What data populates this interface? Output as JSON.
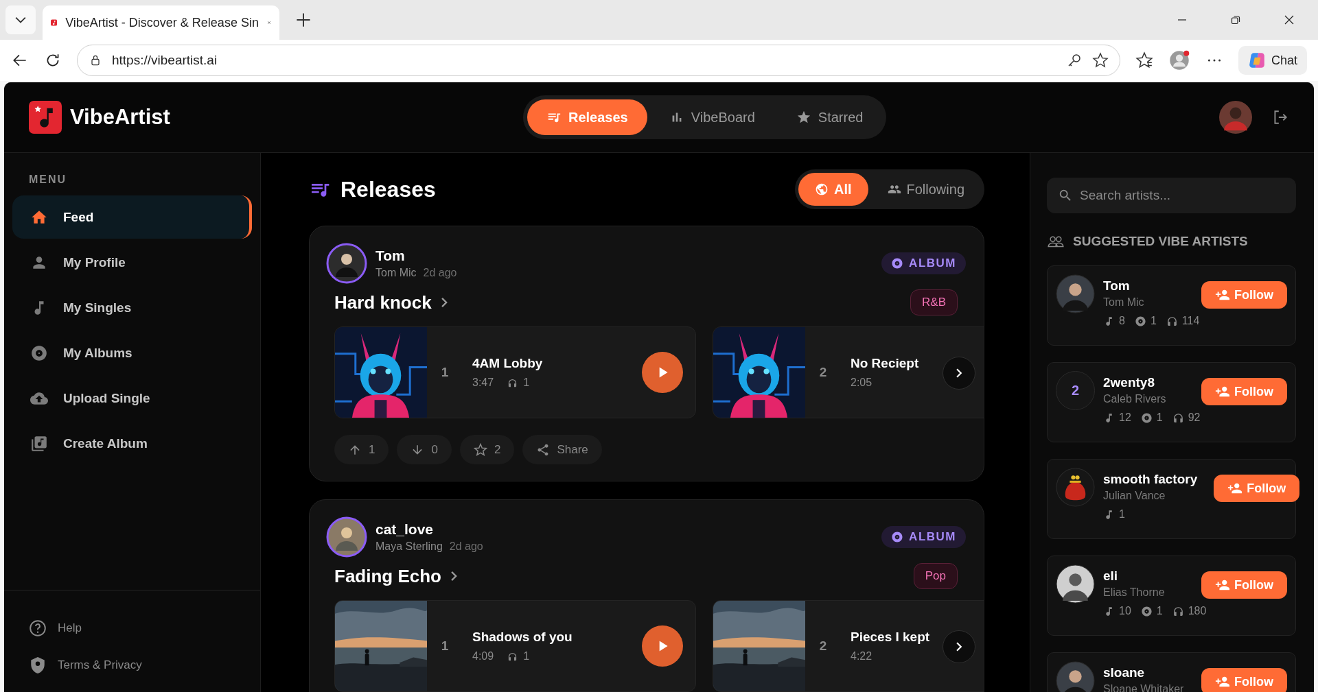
{
  "browser": {
    "tab_title": "VibeArtist - Discover & Release Sin",
    "url": "https://vibeartist.ai",
    "chat_label": "Chat"
  },
  "header": {
    "brand": "VibeArtist",
    "nav": [
      {
        "label": "Releases",
        "selected": true
      },
      {
        "label": "VibeBoard",
        "selected": false
      },
      {
        "label": "Starred",
        "selected": false
      }
    ]
  },
  "sidebar": {
    "menu_label": "MENU",
    "items": [
      {
        "label": "Feed",
        "selected": true
      },
      {
        "label": "My Profile",
        "selected": false
      },
      {
        "label": "My Singles",
        "selected": false
      },
      {
        "label": "My Albums",
        "selected": false
      },
      {
        "label": "Upload Single",
        "selected": false
      },
      {
        "label": "Create Album",
        "selected": false
      }
    ],
    "footer": [
      "Help",
      "Terms & Privacy"
    ]
  },
  "feed": {
    "title": "Releases",
    "filters": [
      {
        "label": "All",
        "selected": true
      },
      {
        "label": "Following",
        "selected": false
      }
    ],
    "posts": [
      {
        "username": "Tom",
        "display_name": "Tom Mic",
        "time": "2d ago",
        "type_label": "ALBUM",
        "title": "Hard knock",
        "genre": "R&B",
        "tracks": [
          {
            "number": "1",
            "title": "4AM Lobby",
            "duration": "3:47",
            "plays": "1"
          },
          {
            "number": "2",
            "title": "No Reciept",
            "duration": "2:05"
          }
        ],
        "actions": [
          "1",
          "0",
          "2",
          "Share"
        ]
      },
      {
        "username": "cat_love",
        "display_name": "Maya Sterling",
        "time": "2d ago",
        "type_label": "ALBUM",
        "title": "Fading Echo",
        "genre": "Pop",
        "tracks": [
          {
            "number": "1",
            "title": "Shadows of you",
            "duration": "4:09",
            "plays": "1"
          },
          {
            "number": "2",
            "title": "Pieces I kept",
            "duration": "4:22"
          }
        ]
      }
    ]
  },
  "suggestions": {
    "search_placeholder": "Search artists...",
    "heading": "SUGGESTED VIBE ARTISTS",
    "artists": [
      {
        "name": "Tom",
        "real_name": "Tom Mic",
        "avatar": {
          "kind": "person"
        },
        "follow_label": "Follow",
        "stats": [
          {
            "kind": "singles",
            "value": "8"
          },
          {
            "kind": "albums",
            "value": "1"
          },
          {
            "kind": "listens",
            "value": "114"
          }
        ]
      },
      {
        "name": "2wenty8",
        "real_name": "Caleb Rivers",
        "avatar": {
          "kind": "initial",
          "text": "2"
        },
        "follow_label": "Follow",
        "stats": [
          {
            "kind": "singles",
            "value": "12"
          },
          {
            "kind": "albums",
            "value": "1"
          },
          {
            "kind": "listens",
            "value": "92"
          }
        ]
      },
      {
        "name": "smooth factory",
        "real_name": "Julian Vance",
        "avatar": {
          "kind": "object"
        },
        "follow_label": "Follow",
        "stats": [
          {
            "kind": "singles",
            "value": "1"
          }
        ]
      },
      {
        "name": "eli",
        "real_name": "Elias Thorne",
        "avatar": {
          "kind": "person"
        },
        "follow_label": "Follow",
        "stats": [
          {
            "kind": "singles",
            "value": "10"
          },
          {
            "kind": "albums",
            "value": "1"
          },
          {
            "kind": "listens",
            "value": "180"
          }
        ]
      },
      {
        "name": "sloane",
        "real_name": "Sloane Whitaker",
        "avatar": {
          "kind": "person"
        },
        "follow_label": "Follow"
      }
    ]
  }
}
